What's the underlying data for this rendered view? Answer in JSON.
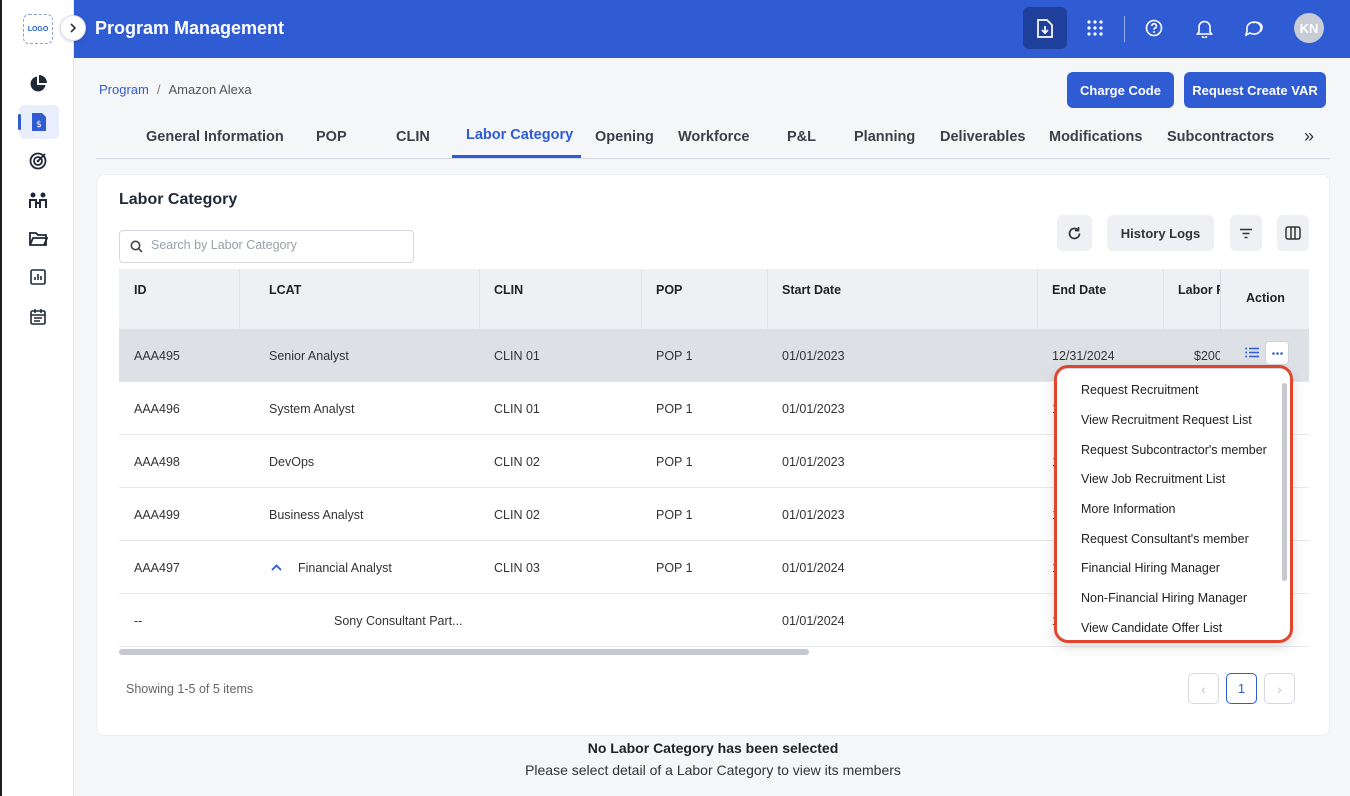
{
  "sidebar": {
    "logo_text": "LOGO",
    "icons": [
      "pie-chart-icon",
      "invoice-icon",
      "target-icon",
      "people-icon",
      "folder-icon",
      "report-icon",
      "calendar-icon"
    ]
  },
  "header": {
    "title": "Program Management",
    "avatar_initials": "KN",
    "accent_color": "#2f5bd3"
  },
  "breadcrumb": {
    "root": "Program",
    "current": "Amazon Alexa"
  },
  "actions": {
    "charge_code": "Charge Code",
    "request_create_var": "Request Create VAR"
  },
  "tabs": [
    "General Information",
    "POP",
    "CLIN",
    "Labor Category",
    "Opening",
    "Workforce",
    "P&L",
    "Planning",
    "Deliverables",
    "Modifications",
    "Subcontractors"
  ],
  "active_tab": "Labor Category",
  "panel": {
    "title": "Labor Category",
    "search_placeholder": "Search by Labor Category",
    "history_logs": "History Logs"
  },
  "table": {
    "columns": [
      "ID",
      "LCAT",
      "CLIN",
      "POP",
      "Start Date",
      "End Date",
      "Labor R",
      "Action"
    ],
    "rows": [
      {
        "id": "AAA495",
        "lcat": "Senior Analyst",
        "clin": "CLIN 01",
        "pop": "POP 1",
        "start": "01/01/2023",
        "end": "12/31/2024",
        "rate": "$200"
      },
      {
        "id": "AAA496",
        "lcat": "System Analyst",
        "clin": "CLIN 01",
        "pop": "POP 1",
        "start": "01/01/2023",
        "end": "1",
        "rate": ""
      },
      {
        "id": "AAA498",
        "lcat": "DevOps",
        "clin": "CLIN 02",
        "pop": "POP 1",
        "start": "01/01/2023",
        "end": "1",
        "rate": ""
      },
      {
        "id": "AAA499",
        "lcat": "Business Analyst",
        "clin": "CLIN 02",
        "pop": "POP 1",
        "start": "01/01/2023",
        "end": "1",
        "rate": ""
      },
      {
        "id": "AAA497",
        "lcat": "Financial Analyst",
        "clin": "CLIN 03",
        "pop": "POP 1",
        "start": "01/01/2024",
        "end": "1",
        "rate": ""
      },
      {
        "id": "--",
        "lcat": "Sony Consultant Part...",
        "clin": "",
        "pop": "",
        "start": "01/01/2024",
        "end": "1",
        "rate": ""
      }
    ]
  },
  "dropdown": {
    "items": [
      "Request Recruitment",
      "View Recruitment Request List",
      "Request Subcontractor's member",
      "View Job Recruitment List",
      "More Information",
      "Request Consultant's member",
      "Financial Hiring Manager",
      "Non-Financial Hiring Manager",
      "View Candidate Offer List"
    ]
  },
  "pagination": {
    "showing": "Showing 1-5 of 5 items",
    "current_page": "1",
    "prev": "‹",
    "next": "›"
  },
  "empty_state": {
    "title": "No Labor Category has been selected",
    "subtitle": "Please select detail of a Labor Category to view its members"
  }
}
